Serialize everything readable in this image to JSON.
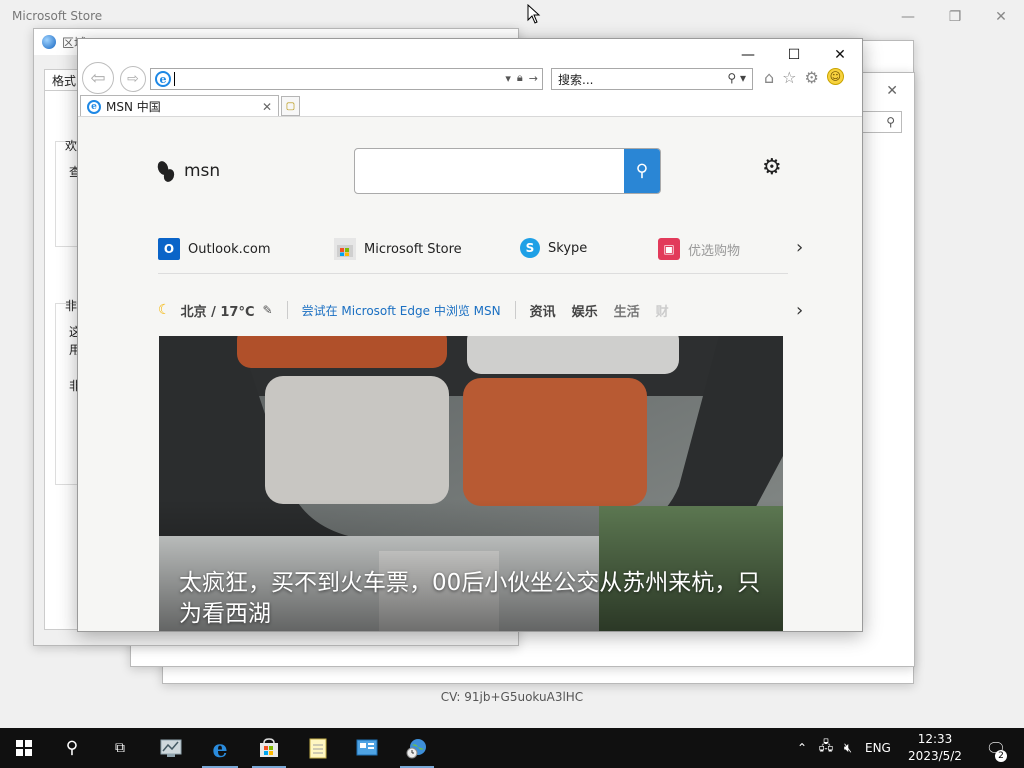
{
  "store": {
    "title": "Microsoft Store",
    "controls": {
      "minimize": "—",
      "restore": "❐",
      "close": "✕"
    },
    "cv_text": "CV: 91jb+G5uokuA3lHC"
  },
  "background_windows": {
    "dialog": {
      "title": "区域",
      "tab": "格式",
      "text_1": "欢",
      "text_2": "查",
      "text_3": "非",
      "text_4": "这",
      "text_5": "用",
      "text_6": "非"
    },
    "win_b_close": "✕",
    "win_b_search_icon": "search-icon"
  },
  "ie": {
    "controls": {
      "minimize": "—",
      "maximize": "☐",
      "close": "✕"
    },
    "address_value": "",
    "search_placeholder": "搜索...",
    "tab_title": "MSN 中国",
    "tab_close": "✕"
  },
  "msn": {
    "logo_text": "msn",
    "search_value": "",
    "quicklinks": [
      {
        "label": "Outlook.com",
        "icon": "outlook-icon",
        "color": "#0a64c8"
      },
      {
        "label": "Microsoft Store",
        "icon": "store-icon",
        "color": "#7a7a7a"
      },
      {
        "label": "Skype",
        "icon": "skype-icon",
        "color": "#1ea0e6"
      },
      {
        "label": "优选购物",
        "icon": "shopping-bag-icon",
        "color": "#e23a5a"
      }
    ],
    "weather": "北京 / 17°C",
    "edge_link": "尝试在 Microsoft Edge 中浏览 MSN",
    "nav": [
      "资讯",
      "娱乐",
      "生活",
      "财"
    ],
    "hero_caption": "太疯狂，买不到火车票，00后小伙坐公交从苏州来杭，只为看西湖"
  },
  "taskbar": {
    "lang": "ENG",
    "time": "12:33",
    "date": "2023/5/2",
    "notifications": "2"
  }
}
